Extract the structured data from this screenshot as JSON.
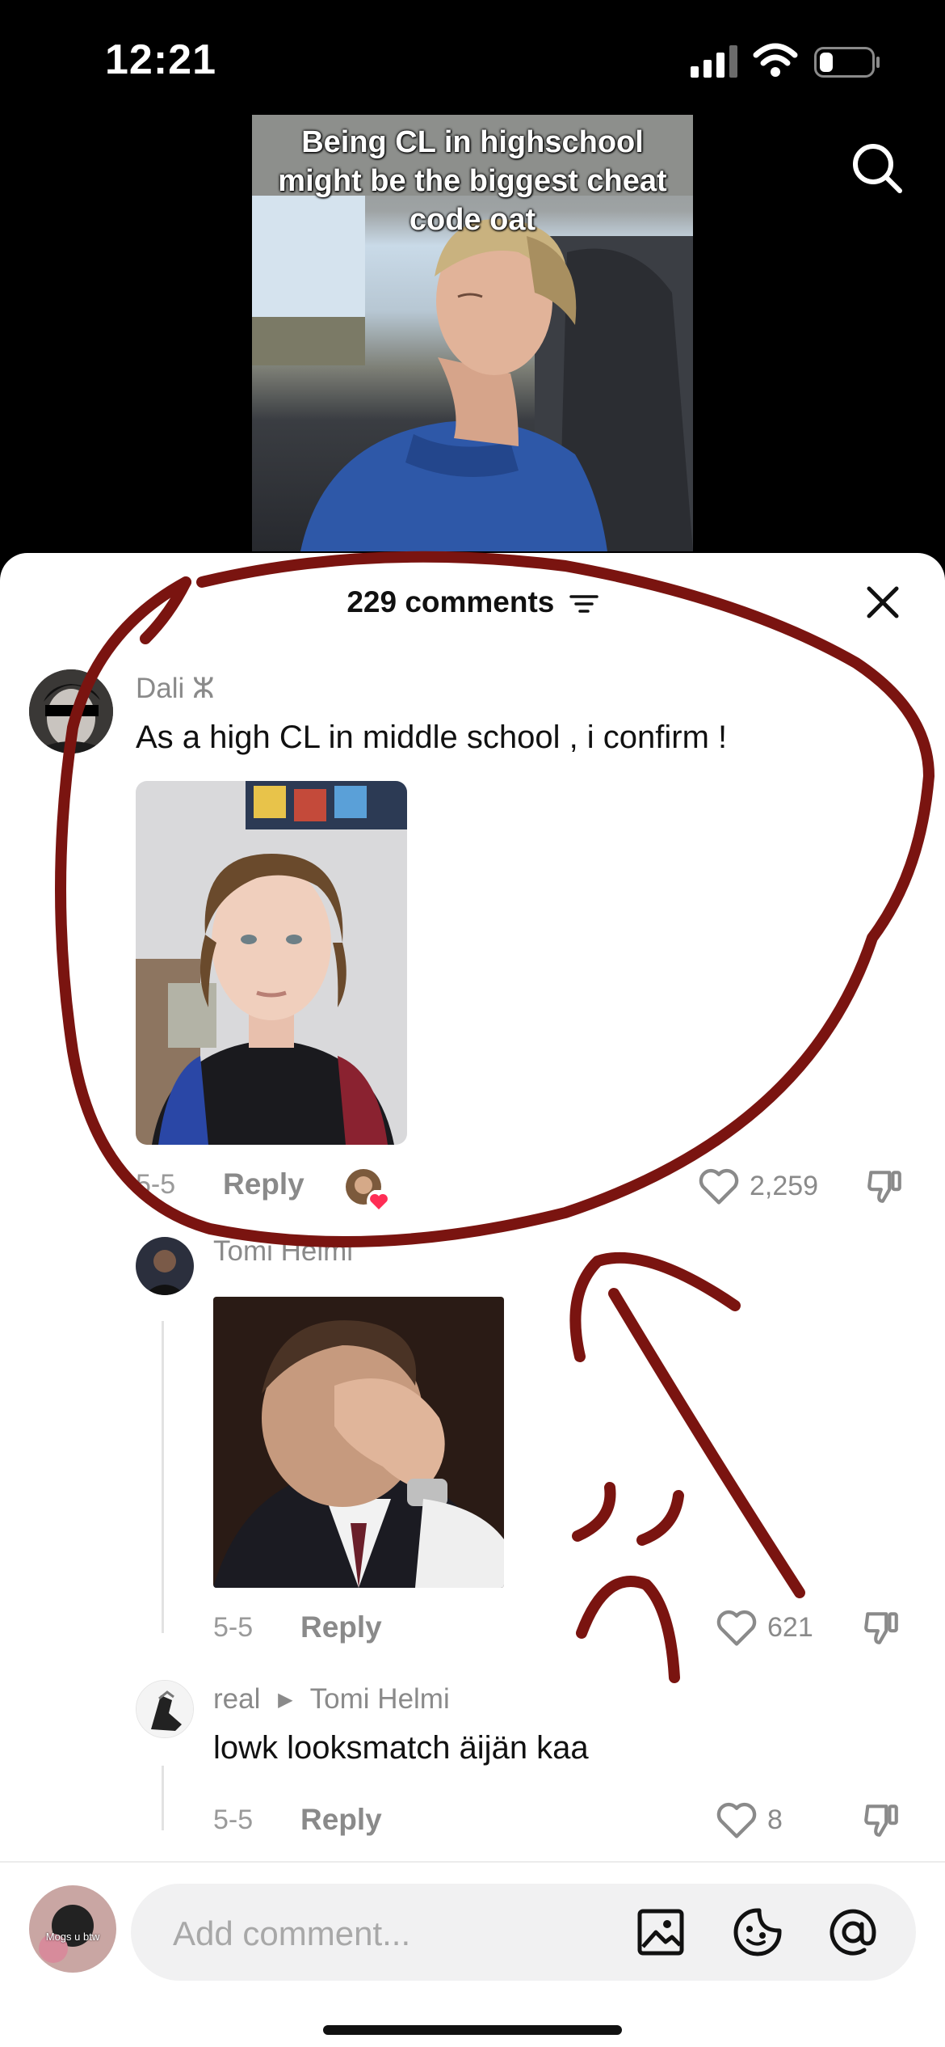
{
  "status_bar": {
    "time": "12:21",
    "battery_level": 0.25
  },
  "video": {
    "caption": "Being CL in highschool might be the biggest cheat code oat"
  },
  "sheet": {
    "comment_count": "229 comments"
  },
  "comments": [
    {
      "username": "Dali ⵣ",
      "text": "As a high CL in middle school , i confirm !",
      "date": "5-5",
      "reply_label": "Reply",
      "likes": "2,259"
    },
    {
      "username": "Tomi Helmi",
      "date": "5-5",
      "reply_label": "Reply",
      "likes": "621"
    },
    {
      "username": "real",
      "reply_to": "Tomi Helmi",
      "text": "lowk looksmatch äijän kaa",
      "date": "5-5",
      "reply_label": "Reply",
      "likes": "8"
    }
  ],
  "input": {
    "placeholder": "Add comment...",
    "avatar_text": "Mogs u btw"
  },
  "icons": {
    "search": "search-icon",
    "filter": "filter-icon",
    "close": "close-icon",
    "heart": "heart-outline-icon",
    "dislike": "thumbs-down-icon",
    "image": "image-icon",
    "sticker": "sticker-icon",
    "mention": "at-mention-icon"
  },
  "colors": {
    "annotation": "#7a1410",
    "like_heart_badge": "#ff2d55"
  }
}
